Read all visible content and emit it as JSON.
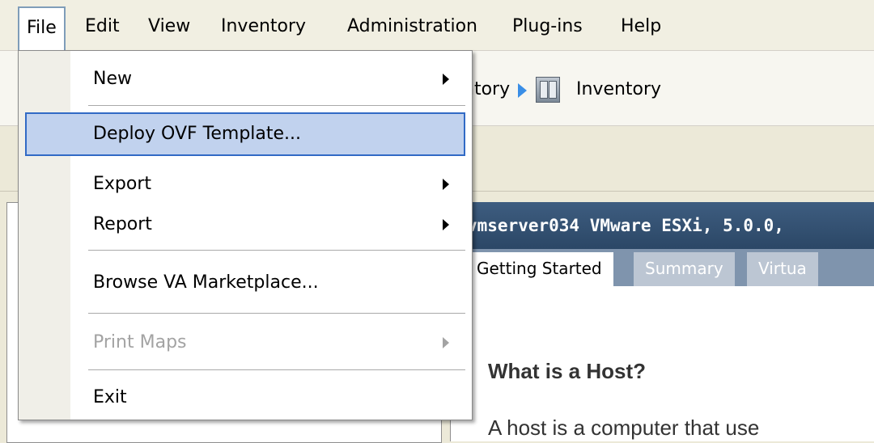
{
  "menubar": {
    "items": [
      "File",
      "Edit",
      "View",
      "Inventory",
      "Administration",
      "Plug-ins",
      "Help"
    ]
  },
  "navbar": {
    "crumb_partial": "ntory",
    "crumb_current": "Inventory"
  },
  "main": {
    "host_title": "vmserver034 VMware ESXi, 5.0.0,",
    "tabs": [
      "Getting Started",
      "Summary",
      "Virtua"
    ],
    "heading": "What is a Host?",
    "paragraph": "A host is a computer that use"
  },
  "file_menu": {
    "items": [
      {
        "label": "New",
        "submenu": true,
        "disabled": false
      },
      {
        "label": "Deploy OVF Template...",
        "submenu": false,
        "disabled": false,
        "highlighted": true
      },
      {
        "label": "Export",
        "submenu": true,
        "disabled": false
      },
      {
        "label": "Report",
        "submenu": true,
        "disabled": false
      },
      {
        "label": "Browse VA Marketplace...",
        "submenu": false,
        "disabled": false
      },
      {
        "label": "Print Maps",
        "submenu": true,
        "disabled": true
      },
      {
        "label": "Exit",
        "submenu": false,
        "disabled": false
      }
    ]
  },
  "colors": {
    "highlight_bg": "#c1d2ee",
    "highlight_border": "#316ac5",
    "host_bar": "#2b4766"
  }
}
